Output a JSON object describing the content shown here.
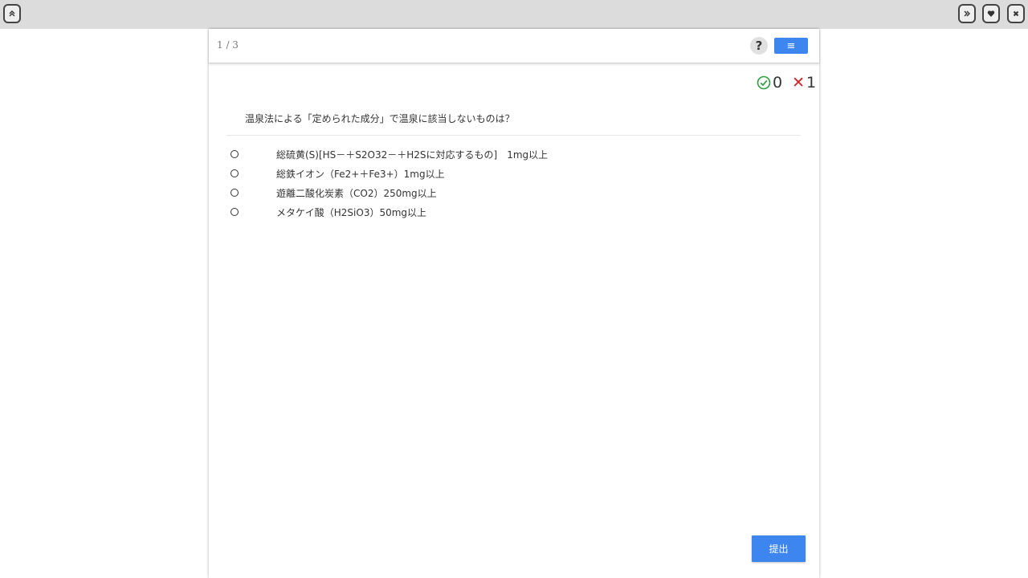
{
  "toolbar": {
    "left_icon": "chevrons-up-icon",
    "right_icons": [
      "chevrons-right-icon",
      "heart-icon",
      "close-icon"
    ]
  },
  "header": {
    "page_counter": "1 / 3",
    "help_label": "?",
    "menu_label": "≡"
  },
  "score": {
    "correct": "0",
    "wrong": "1",
    "wrong_symbol": "✕"
  },
  "question": {
    "text": "温泉法による「定められた成分」で温泉に該当しないものは？",
    "options": [
      "総硫黄(S)[HS－＋S2O32－＋H2Sに対応するもの]　1mg以上",
      "総鉄イオン（Fe2+＋Fe3+）1mg以上",
      "遊離二酸化炭素（CO2）250mg以上",
      "メタケイ酸（H2SiO3）50mg以上"
    ]
  },
  "submit_label": "提出",
  "colors": {
    "accent": "#3d86f0",
    "correct": "#2e9e3e",
    "wrong": "#d32626",
    "topbar": "#dcdcdc"
  }
}
